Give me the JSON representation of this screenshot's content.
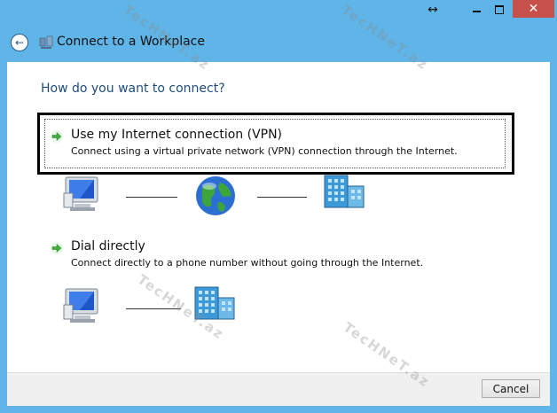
{
  "window": {
    "title": "Connect to a Workplace",
    "close_glyph": "✕",
    "resize_glyph": "↔"
  },
  "page": {
    "question": "How do you want to connect?"
  },
  "options": [
    {
      "title": "Use my Internet connection (VPN)",
      "description": "Connect using a virtual private network (VPN) connection through the Internet."
    },
    {
      "title": "Dial directly",
      "description": "Connect directly to a phone number without going through the Internet."
    }
  ],
  "footer": {
    "cancel_label": "Cancel"
  },
  "watermark": {
    "text": "TecHNeT.az"
  },
  "icons": {
    "back": "back-arrow-icon",
    "option_arrow": "green-arrow-icon",
    "computer": "computer-icon",
    "globe": "globe-icon",
    "building": "building-icon"
  },
  "colors": {
    "title_bar": "#5fb4e8",
    "close_button": "#c7504a",
    "question_text": "#1e4d7b",
    "arrow_green": "#3fae3f",
    "highlight_border": "#000000"
  }
}
